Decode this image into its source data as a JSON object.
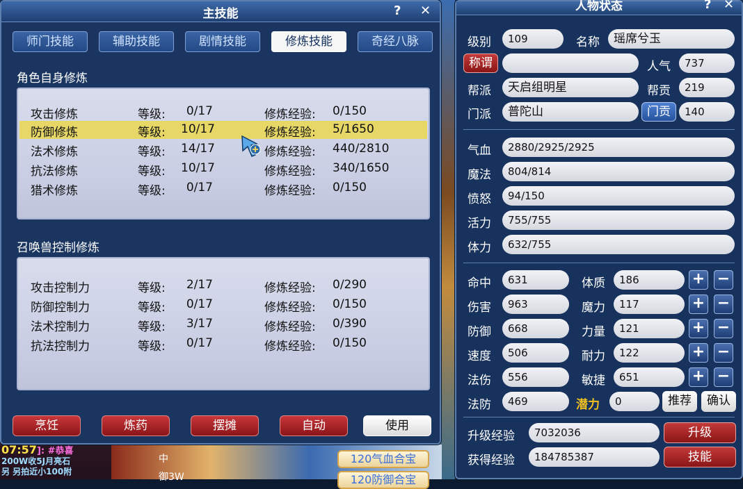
{
  "skills_window": {
    "title": "主技能",
    "help": "?",
    "close": "✕",
    "tabs": [
      "师门技能",
      "辅助技能",
      "剧情技能",
      "修炼技能",
      "奇经八脉"
    ],
    "section1": {
      "title": "角色自身修炼",
      "rows": [
        {
          "name": "攻击修炼",
          "lvl_label": "等级:",
          "lvl": "0/17",
          "exp_label": "修炼经验:",
          "exp": "0/150"
        },
        {
          "name": "防御修炼",
          "lvl_label": "等级:",
          "lvl": "10/17",
          "exp_label": "修炼经验:",
          "exp": "5/1650"
        },
        {
          "name": "法术修炼",
          "lvl_label": "等级:",
          "lvl": "14/17",
          "exp_label": "修炼经验:",
          "exp": "440/2810"
        },
        {
          "name": "抗法修炼",
          "lvl_label": "等级:",
          "lvl": "10/17",
          "exp_label": "修炼经验:",
          "exp": "340/1650"
        },
        {
          "name": "猎术修炼",
          "lvl_label": "等级:",
          "lvl": "0/17",
          "exp_label": "修炼经验:",
          "exp": "0/150"
        }
      ]
    },
    "section2": {
      "title": "召唤兽控制修炼",
      "rows": [
        {
          "name": "攻击控制力",
          "lvl_label": "等级:",
          "lvl": "2/17",
          "exp_label": "修炼经验:",
          "exp": "0/290"
        },
        {
          "name": "防御控制力",
          "lvl_label": "等级:",
          "lvl": "0/17",
          "exp_label": "修炼经验:",
          "exp": "0/150"
        },
        {
          "name": "法术控制力",
          "lvl_label": "等级:",
          "lvl": "3/17",
          "exp_label": "修炼经验:",
          "exp": "0/390"
        },
        {
          "name": "抗法控制力",
          "lvl_label": "等级:",
          "lvl": "0/17",
          "exp_label": "修炼经验:",
          "exp": "0/150"
        }
      ]
    },
    "buttons": [
      "烹饪",
      "炼药",
      "摆摊",
      "自动",
      "使用"
    ]
  },
  "status_window": {
    "title": "人物状态",
    "help": "?",
    "close": "✕",
    "level_label": "级别",
    "level": "109",
    "name_label": "名称",
    "name": "瑶席兮玉",
    "title_label": "称谓",
    "title_value": "",
    "popularity_label": "人气",
    "popularity": "737",
    "gang_label": "帮派",
    "gang": "天启组明星",
    "gang_contrib_label": "帮贡",
    "gang_contrib": "219",
    "school_label": "门派",
    "school": "普陀山",
    "school_contrib_label": "门贡",
    "school_contrib": "140",
    "bars": [
      {
        "label": "气血",
        "value": "2880/2925/2925"
      },
      {
        "label": "魔法",
        "value": "804/814"
      },
      {
        "label": "愤怒",
        "value": "94/150"
      },
      {
        "label": "活力",
        "value": "755/755"
      },
      {
        "label": "体力",
        "value": "632/755"
      }
    ],
    "stats_left": [
      {
        "label": "命中",
        "value": "631"
      },
      {
        "label": "伤害",
        "value": "963"
      },
      {
        "label": "防御",
        "value": "668"
      },
      {
        "label": "速度",
        "value": "506"
      },
      {
        "label": "法伤",
        "value": "556"
      },
      {
        "label": "法防",
        "value": "469"
      }
    ],
    "stats_right": [
      {
        "label": "体质",
        "value": "186"
      },
      {
        "label": "魔力",
        "value": "117"
      },
      {
        "label": "力量",
        "value": "121"
      },
      {
        "label": "耐力",
        "value": "122"
      },
      {
        "label": "敏捷",
        "value": "651"
      }
    ],
    "potential_label": "潜力",
    "potential": "0",
    "recommend_btn": "推荐",
    "confirm_btn": "确认",
    "plus": "+",
    "minus": "−",
    "upgrade_exp_label": "升级经验",
    "upgrade_exp": "7032036",
    "upgrade_btn": "升级",
    "gained_exp_label": "获得经验",
    "gained_exp": "184785387",
    "skills_btn": "技能"
  },
  "scene": {
    "chat_time": "07:57",
    "chat_tag": "]: #恭喜",
    "chat_line1": "200W收5J月亮石",
    "chat_line2": "另 另拍近小100附",
    "badge1": "120气血合宝",
    "badge2": "120防御合宝",
    "tiny1": "中",
    "tiny2": "御3W"
  },
  "colors": {
    "highlight_row": "#e6d766",
    "title_bar": "#2a5490",
    "red_button": "#a8201f",
    "potential": "#f0c020"
  }
}
